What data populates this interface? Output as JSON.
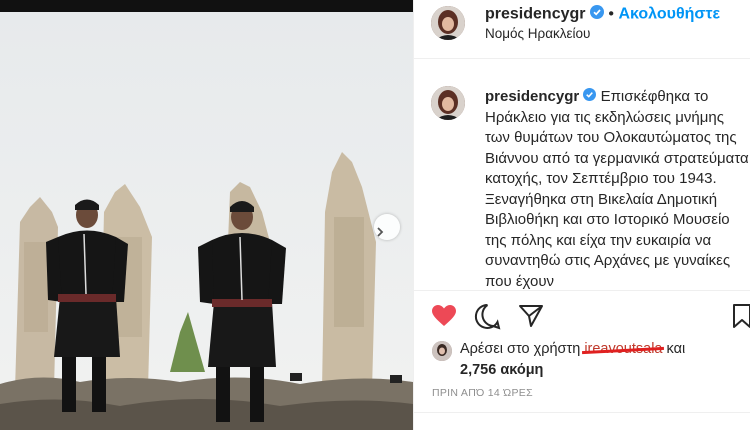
{
  "post": {
    "username": "presidencygr",
    "follow_label": "Ακολουθήστε",
    "separator": "•",
    "location": "Νομός Ηρακλείου",
    "caption_text": "Επισκέφθηκα το Ηράκλειο για τις εκδηλώσεις μνήμης των θυμάτων του Ολοκαυτώματος της Βιάννου από τα γερμανικά στρατεύματα κατοχής, τον Σεπτέμβριο του 1943. Ξεναγήθηκα στη Βικελαία Δημοτική Βιβλιοθήκη και στο Ιστορικό Μουσείο της πόλης και είχα την ευκαιρία να συναντηθώ στις Αρχάνες με γυναίκες που έχουν",
    "likes_prefix": "Αρέσει στο χρήστη",
    "liker_name": "ireavoutsala",
    "likes_and": "και",
    "likes_count": "2,756 ακόμη",
    "timestamp": "ΠΡΙΝ ΑΠΌ 14 ΏΡΕΣ"
  },
  "colors": {
    "like_active": "#ed4956",
    "link_blue": "#0095f6",
    "verified_blue": "#3897f0"
  },
  "icons": {
    "like": "heart-icon",
    "comment": "comment-icon",
    "share": "paper-plane-icon",
    "save": "bookmark-icon",
    "verified": "verified-badge-icon",
    "next": "chevron-right-icon"
  }
}
